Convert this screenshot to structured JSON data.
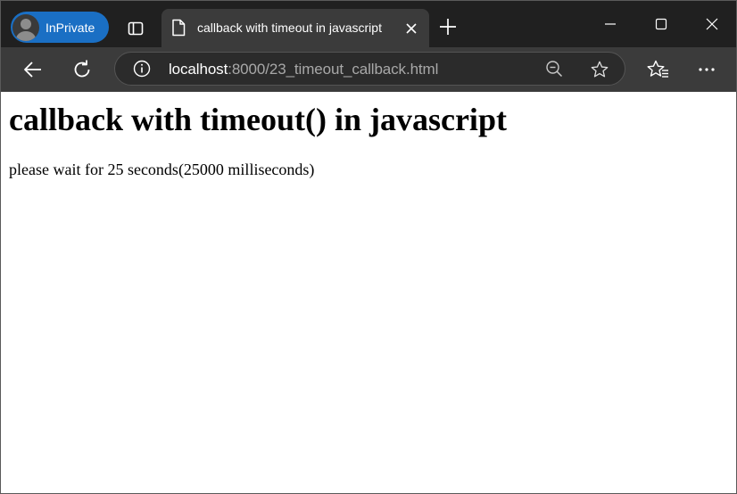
{
  "browser": {
    "profile_label": "InPrivate",
    "tab": {
      "title": "callback with timeout in javascript"
    },
    "address": {
      "host": "localhost",
      "rest": ":8000/23_timeout_callback.html"
    },
    "colors": {
      "tabstrip_bg": "#202020",
      "toolbar_bg": "#3b3b3b",
      "inprivate_badge": "#1a6fc4"
    },
    "icons": {
      "tab_actions": "tab-actions-icon",
      "favicon": "page-icon",
      "tab_close": "close-icon",
      "new_tab": "plus-icon",
      "minimize": "minimize-icon",
      "maximize": "maximize-icon",
      "close_window": "close-icon",
      "back": "back-arrow-icon",
      "refresh": "refresh-icon",
      "site_info": "info-icon",
      "zoom": "zoom-out-icon",
      "favorite": "star-icon",
      "favorites": "favorites-icon",
      "menu": "more-icon"
    }
  },
  "page": {
    "heading": "callback with timeout() in javascript",
    "message": "please wait for 25 seconds(25000 milliseconds)"
  }
}
